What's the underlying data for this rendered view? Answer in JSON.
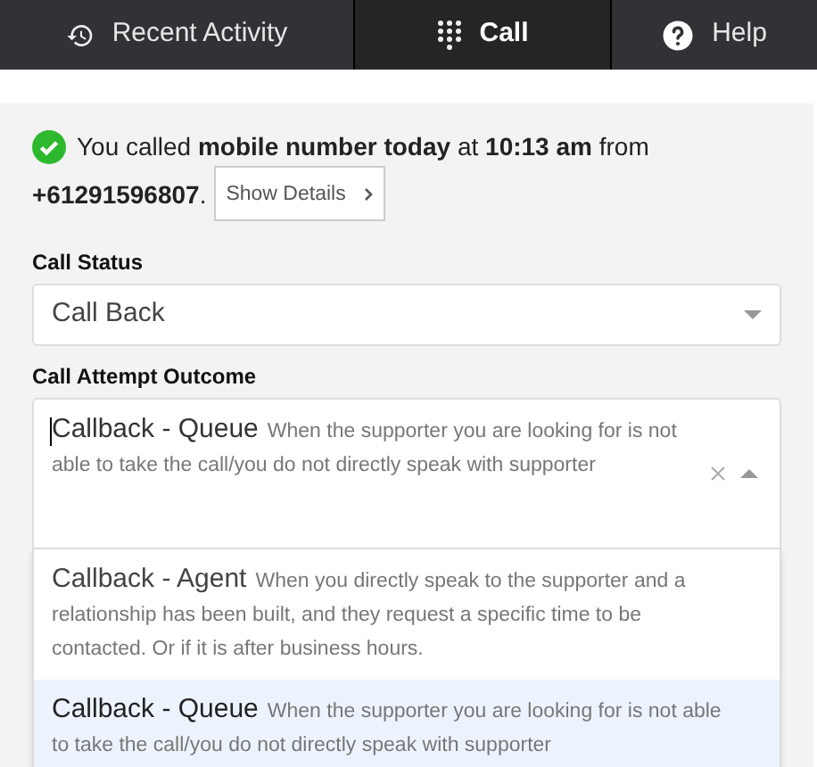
{
  "tabs": [
    {
      "label": "Recent Activity",
      "selected": false
    },
    {
      "label": "Call",
      "selected": true
    },
    {
      "label": "Help",
      "selected": false
    }
  ],
  "call_summary": {
    "message_lines": [
      "You called **mobile number today** at **10:13 am** from",
      "**+61291596807**."
    ],
    "details_button": "Show Details"
  },
  "call_status": {
    "label": "Call Status",
    "value": "Call Back"
  },
  "call_attempt_outcome": {
    "label": "Call Attempt Outcome",
    "value": {
      "title": "Callback - Queue",
      "description": "When the supporter you are looking for is not able to take the call/you do not directly speak with supporter"
    },
    "expanded": true,
    "options": [
      {
        "title": "Callback - Agent",
        "description": "When you directly speak to the supporter and a relationship has been built, and they request a specific time to be contacted. Or if it is after business hours.",
        "selected": false
      },
      {
        "title": "Callback - Queue",
        "description": "When the supporter you are looking for is not able to take the call/you do not directly speak with supporter",
        "selected": true
      }
    ]
  }
}
